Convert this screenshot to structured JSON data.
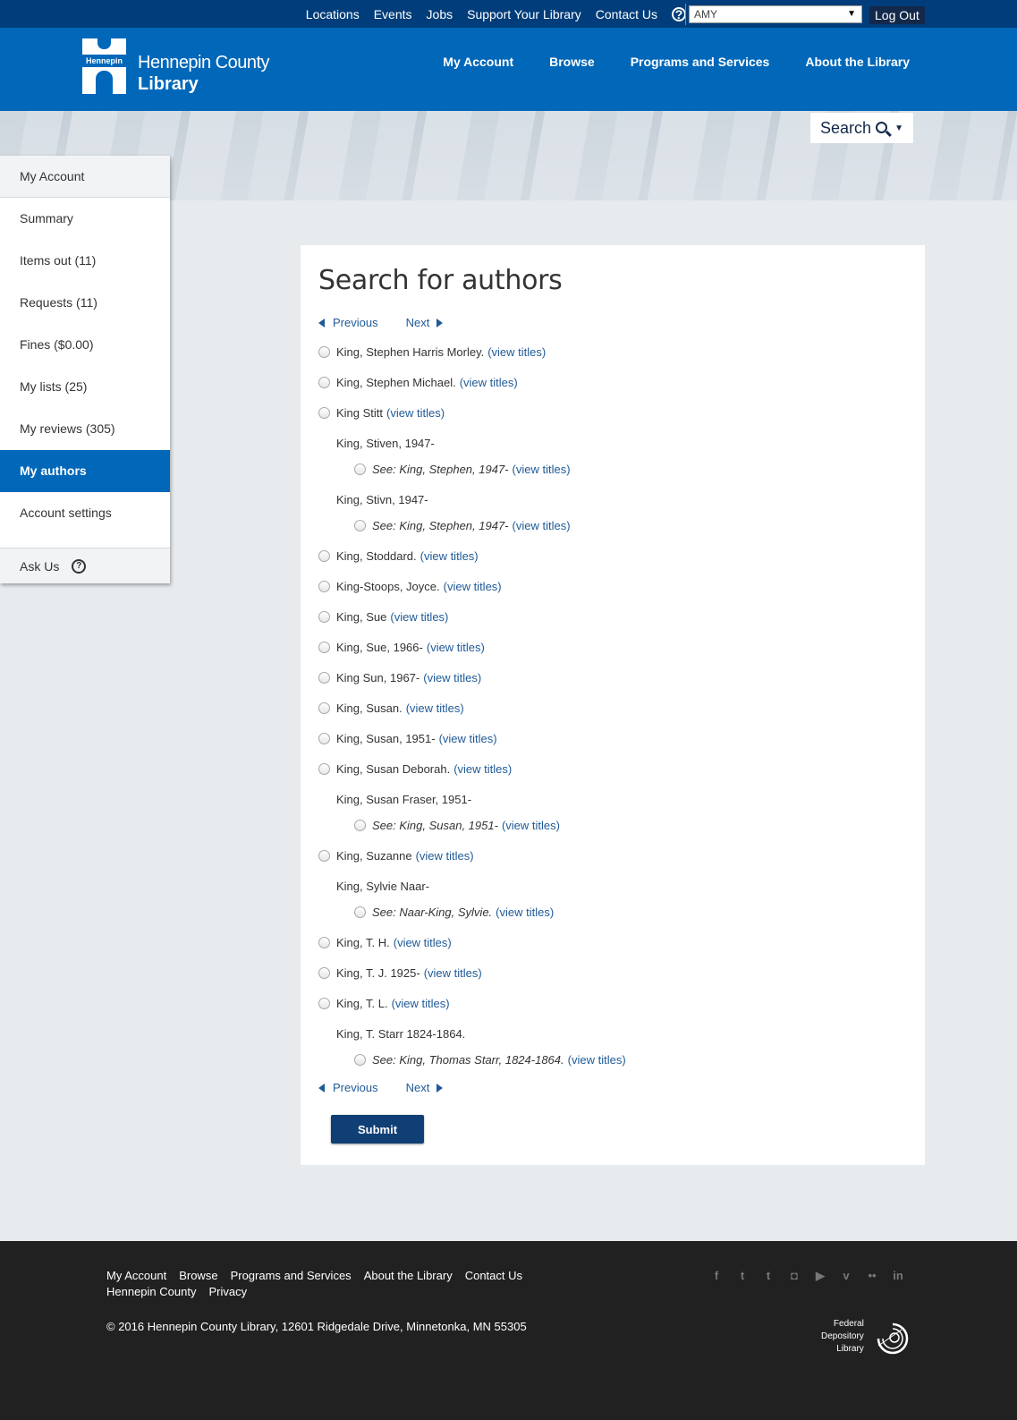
{
  "utility": {
    "links": [
      "Locations",
      "Events",
      "Jobs",
      "Support Your Library",
      "Contact Us"
    ],
    "user": "AMY",
    "logout": "Log Out"
  },
  "header": {
    "logo_tag": "Hennepin",
    "logo_line1": "Hennepin County",
    "logo_line2": "Library",
    "nav": [
      "My Account",
      "Browse",
      "Programs and Services",
      "About the Library"
    ]
  },
  "search": {
    "label": "Search"
  },
  "sidebar": {
    "heading": "My Account",
    "items": [
      "Summary",
      "Items out (11)",
      "Requests (11)",
      "Fines ($0.00)",
      "My lists (25)",
      "My reviews (305)",
      "My authors",
      "Account settings"
    ],
    "active": "My authors",
    "ask": "Ask Us"
  },
  "main": {
    "title": "Search for authors",
    "previous": "Previous",
    "next": "Next",
    "view_titles": "(view titles)",
    "submit": "Submit",
    "entries": [
      {
        "kind": "author",
        "text": "King, Stephen Harris Morley."
      },
      {
        "kind": "author",
        "text": "King, Stephen Michael."
      },
      {
        "kind": "author",
        "text": "King Stitt"
      },
      {
        "kind": "label",
        "text": "King, Stiven, 1947-"
      },
      {
        "kind": "see",
        "text": "See: King, Stephen, 1947-"
      },
      {
        "kind": "label",
        "text": "King, Stivn, 1947-"
      },
      {
        "kind": "see",
        "text": "See: King, Stephen, 1947-"
      },
      {
        "kind": "author",
        "text": "King, Stoddard."
      },
      {
        "kind": "author",
        "text": "King-Stoops, Joyce."
      },
      {
        "kind": "author",
        "text": "King, Sue"
      },
      {
        "kind": "author",
        "text": "King, Sue, 1966-"
      },
      {
        "kind": "author",
        "text": "King Sun, 1967-"
      },
      {
        "kind": "author",
        "text": "King, Susan."
      },
      {
        "kind": "author",
        "text": "King, Susan, 1951-"
      },
      {
        "kind": "author",
        "text": "King, Susan Deborah."
      },
      {
        "kind": "label",
        "text": "King, Susan Fraser, 1951-"
      },
      {
        "kind": "see",
        "text": "See: King, Susan, 1951-"
      },
      {
        "kind": "author",
        "text": "King, Suzanne"
      },
      {
        "kind": "label",
        "text": "King, Sylvie Naar-"
      },
      {
        "kind": "see",
        "text": "See: Naar-King, Sylvie."
      },
      {
        "kind": "author",
        "text": "King, T. H."
      },
      {
        "kind": "author",
        "text": "King, T. J. 1925-"
      },
      {
        "kind": "author",
        "text": "King, T. L."
      },
      {
        "kind": "label",
        "text": "King, T. Starr 1824-1864."
      },
      {
        "kind": "see",
        "text": "See: King, Thomas Starr, 1824-1864."
      }
    ]
  },
  "footer": {
    "links_row1": [
      "My Account",
      "Browse",
      "Programs and Services",
      "About the Library",
      "Contact Us"
    ],
    "links_row2": [
      "Hennepin County",
      "Privacy"
    ],
    "copyright": "© 2016 Hennepin County Library, 12601 Ridgedale Drive, Minnetonka, MN 55305",
    "social_icons": [
      "facebook-icon",
      "twitter-icon",
      "tumblr-icon",
      "instagram-icon",
      "youtube-icon",
      "vimeo-icon",
      "flickr-icon",
      "linkedin-icon"
    ],
    "fdl": [
      "Federal",
      "Depository",
      "Library"
    ]
  }
}
